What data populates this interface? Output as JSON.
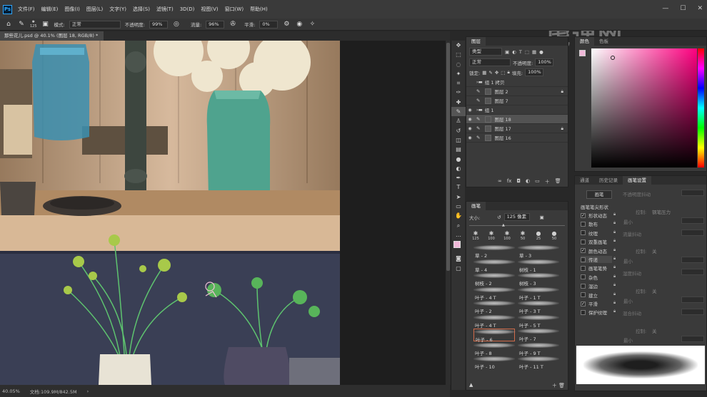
{
  "menubar": {
    "logo": "Ps",
    "items": [
      "文件(F)",
      "编辑(E)",
      "图像(I)",
      "图层(L)",
      "文字(Y)",
      "选择(S)",
      "滤镜(T)",
      "3D(D)",
      "视图(V)",
      "窗口(W)",
      "帮助(H)"
    ]
  },
  "options": {
    "brush_size": "125",
    "mode_label": "模式:",
    "mode_value": "正常",
    "opacity_label": "不透明度:",
    "opacity_value": "99%",
    "flow_label": "流量:",
    "flow_value": "96%",
    "smooth_label": "平滑:",
    "smooth_value": "0%"
  },
  "document": {
    "tab_title": "那些花儿.psd @ 40.1% (图层 18, RGB/8) *",
    "zoom": "40.05%",
    "doc_info": "文档:109.9M/842.5M"
  },
  "layers_panel": {
    "tab": "图层",
    "kind_label": "类型",
    "blend_mode": "正常",
    "opacity_label": "不透明度:",
    "opacity_value": "100%",
    "lock_label": "锁定:",
    "fill_label": "填充:",
    "fill_value": "100%",
    "rows": [
      {
        "name": "组 1 拷贝",
        "visible": false,
        "group": true,
        "locked": false
      },
      {
        "name": "图层 2",
        "visible": false,
        "group": false,
        "locked": true
      },
      {
        "name": "图层 7",
        "visible": false,
        "group": false,
        "locked": false
      },
      {
        "name": "组 1",
        "visible": true,
        "group": true,
        "locked": false
      },
      {
        "name": "图层 18",
        "visible": true,
        "group": false,
        "locked": false,
        "selected": true
      },
      {
        "name": "图层 17",
        "visible": true,
        "group": false,
        "locked": true
      },
      {
        "name": "图层 16",
        "visible": true,
        "group": false,
        "locked": false
      }
    ]
  },
  "brushes_panel": {
    "tab": "画笔",
    "size_label": "大小:",
    "size_value": "125 像素",
    "presets": [
      "125",
      "100",
      "100",
      "50",
      "25",
      "50"
    ],
    "items": [
      "草 - 2",
      "草 - 3",
      "草 - 4",
      "树枝 - 1",
      "树枝 - 2",
      "树枝 - 3",
      "叶子 - 4 T",
      "叶子 - 1 T",
      "叶子 - 2",
      "叶子 - 3 T",
      "叶子 - 4 T",
      "叶子 - 5 T",
      "叶子 - 6",
      "叶子 - 7",
      "叶子 - 8",
      "叶子 - 9 T",
      "叶子 - 10",
      "叶子 - 11 T"
    ]
  },
  "color_panel": {
    "tab": "颜色",
    "tab2": "色板",
    "colors": {
      "foreground": "#f0b8d8",
      "hue": "#ff0080"
    }
  },
  "brush_settings": {
    "tabs": [
      "通道",
      "历史记录",
      "画笔设置"
    ],
    "brush_button": "画笔",
    "tip_shape": "画笔笔尖形状",
    "options": [
      {
        "label": "形状动态",
        "checked": true
      },
      {
        "label": "散布",
        "checked": false
      },
      {
        "label": "纹理",
        "checked": false
      },
      {
        "label": "双重画笔",
        "checked": false
      },
      {
        "label": "颜色动态",
        "checked": true
      },
      {
        "label": "传递",
        "checked": false
      },
      {
        "label": "画笔笔势",
        "checked": false
      },
      {
        "label": "杂色",
        "checked": false
      },
      {
        "label": "湿边",
        "checked": false
      },
      {
        "label": "建立",
        "checked": false
      },
      {
        "label": "平滑",
        "checked": true
      },
      {
        "label": "保护纹理",
        "checked": false
      }
    ],
    "right_labels": {
      "opacity_jitter": "不透明度抖动",
      "control": "控制:",
      "pen_pressure": "钢笔压力",
      "min": "最小",
      "flow_jitter": "流量抖动",
      "off": "关",
      "wet_jitter": "湿度抖动",
      "mix_jitter": "混合抖动"
    }
  },
  "watermark": "虎课网"
}
